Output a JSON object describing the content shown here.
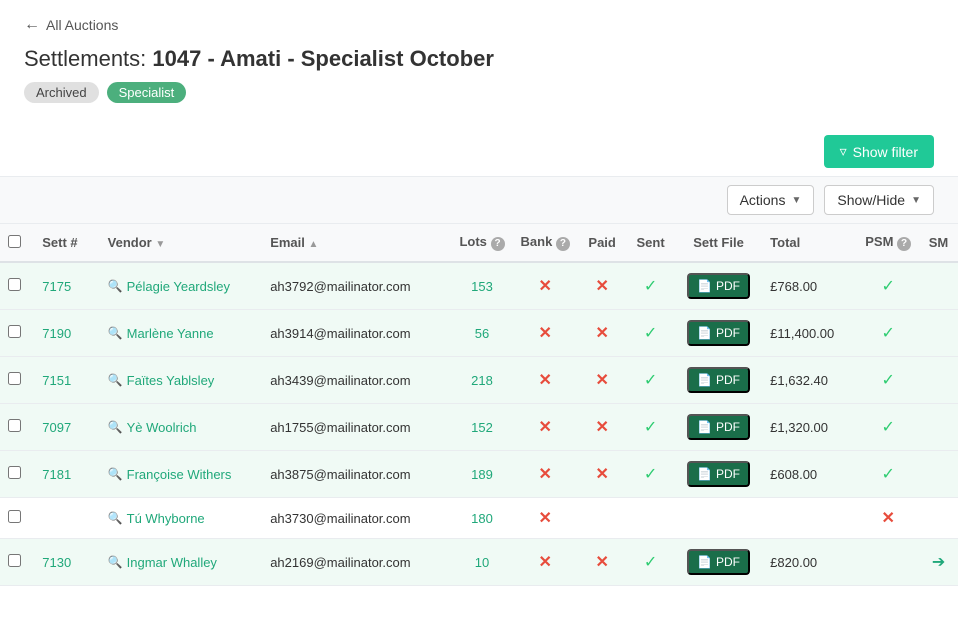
{
  "nav": {
    "back_label": "All Auctions"
  },
  "page": {
    "title_prefix": "Settlements:",
    "title_main": "1047 - Amati - Specialist October"
  },
  "badges": [
    {
      "label": "Archived",
      "type": "archived"
    },
    {
      "label": "Specialist",
      "type": "specialist"
    }
  ],
  "toolbar": {
    "show_filter_label": "Show filter"
  },
  "actions_bar": {
    "actions_label": "Actions",
    "showhide_label": "Show/Hide"
  },
  "table": {
    "columns": [
      {
        "id": "sett",
        "label": "Sett #",
        "sortable": false
      },
      {
        "id": "vendor",
        "label": "Vendor",
        "sortable": true
      },
      {
        "id": "email",
        "label": "Email",
        "sortable": true
      },
      {
        "id": "lots",
        "label": "Lots",
        "sortable": false,
        "help": true
      },
      {
        "id": "bank",
        "label": "Bank",
        "sortable": false,
        "help": true
      },
      {
        "id": "paid",
        "label": "Paid",
        "sortable": false
      },
      {
        "id": "sent",
        "label": "Sent",
        "sortable": false
      },
      {
        "id": "settfile",
        "label": "Sett File",
        "sortable": false
      },
      {
        "id": "total",
        "label": "Total",
        "sortable": false
      },
      {
        "id": "psm",
        "label": "PSM",
        "sortable": false,
        "help": true
      },
      {
        "id": "sm",
        "label": "SM",
        "sortable": false
      }
    ],
    "rows": [
      {
        "sett": "7175",
        "vendor": "Pélagie Yeardsley",
        "email": "ah3792@mailinator.com",
        "lots": "153",
        "bank": "x",
        "paid": "x",
        "sent": "check",
        "settfile": "PDF",
        "total": "£768.00",
        "psm": "check",
        "sm": "",
        "row_class": "row-green"
      },
      {
        "sett": "7190",
        "vendor": "Marlène Yanne",
        "email": "ah3914@mailinator.com",
        "lots": "56",
        "bank": "x",
        "paid": "x",
        "sent": "check",
        "settfile": "PDF",
        "total": "£11,400.00",
        "psm": "check",
        "sm": "",
        "row_class": "row-green"
      },
      {
        "sett": "7151",
        "vendor": "Faïtes Yablsley",
        "email": "ah3439@mailinator.com",
        "lots": "218",
        "bank": "x",
        "paid": "x",
        "sent": "check",
        "settfile": "PDF",
        "total": "£1,632.40",
        "psm": "check",
        "sm": "",
        "row_class": "row-green"
      },
      {
        "sett": "7097",
        "vendor": "Yè Woolrich",
        "email": "ah1755@mailinator.com",
        "lots": "152",
        "bank": "x",
        "paid": "x",
        "sent": "check",
        "settfile": "PDF",
        "total": "£1,320.00",
        "psm": "check",
        "sm": "",
        "row_class": "row-green"
      },
      {
        "sett": "7181",
        "vendor": "Françoise Withers",
        "email": "ah3875@mailinator.com",
        "lots": "189",
        "bank": "x",
        "paid": "x",
        "sent": "check",
        "settfile": "PDF",
        "total": "£608.00",
        "psm": "check",
        "sm": "",
        "row_class": "row-green"
      },
      {
        "sett": "",
        "vendor": "Tú Whyborne",
        "email": "ah3730@mailinator.com",
        "lots": "180",
        "bank": "x",
        "paid": "",
        "sent": "",
        "settfile": "",
        "total": "",
        "psm": "x",
        "sm": "",
        "row_class": "row-white"
      },
      {
        "sett": "7130",
        "vendor": "Ingmar Whalley",
        "email": "ah2169@mailinator.com",
        "lots": "10",
        "bank": "x",
        "paid": "x",
        "sent": "check",
        "settfile": "PDF",
        "total": "£820.00",
        "psm": "",
        "sm": "login",
        "row_class": "row-green"
      }
    ]
  }
}
